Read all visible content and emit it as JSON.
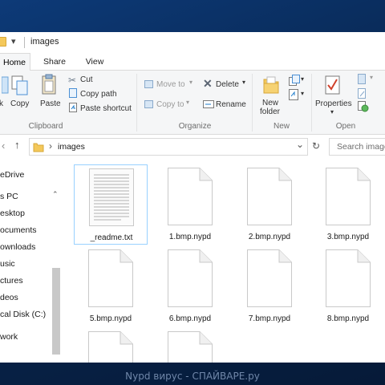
{
  "window": {
    "title": "images",
    "quick_access_glyph": "▾"
  },
  "tabs": [
    {
      "label": "Home",
      "active": true
    },
    {
      "label": "Share",
      "active": false
    },
    {
      "label": "View",
      "active": false
    }
  ],
  "ribbon": {
    "clipboard": {
      "pin_label_fragment": "k",
      "copy": "Copy",
      "paste": "Paste",
      "cut": "Cut",
      "copy_path": "Copy path",
      "paste_shortcut": "Paste shortcut",
      "group": "Clipboard"
    },
    "organize": {
      "move_to": "Move to",
      "copy_to": "Copy to",
      "delete": "Delete",
      "rename": "Rename",
      "group": "Organize"
    },
    "new": {
      "new_folder_line1": "New",
      "new_folder_line2": "folder",
      "group": "New"
    },
    "open": {
      "properties": "Properties",
      "group": "Open"
    }
  },
  "address": {
    "back_glyph": "‹",
    "up_glyph": "↑",
    "separator": "›",
    "path": "images",
    "dropdown_glyph": "⌄",
    "refresh_glyph": "↻",
    "search_placeholder": "Search images"
  },
  "nav_pane": {
    "items": [
      {
        "label": "eDrive"
      },
      {
        "label": "s PC"
      },
      {
        "label": "esktop"
      },
      {
        "label": "ocuments"
      },
      {
        "label": "ownloads"
      },
      {
        "label": "usic"
      },
      {
        "label": "ctures"
      },
      {
        "label": "deos"
      },
      {
        "label": "cal Disk (C:)"
      },
      {
        "label": "work"
      }
    ]
  },
  "files": [
    {
      "name": "_readme.txt",
      "type": "txt",
      "selected": true
    },
    {
      "name": "1.bmp.nypd",
      "type": "blank",
      "selected": false
    },
    {
      "name": "2.bmp.nypd",
      "type": "blank",
      "selected": false
    },
    {
      "name": "3.bmp.nypd",
      "type": "blank",
      "selected": false
    },
    {
      "name": "5.bmp.nypd",
      "type": "blank",
      "selected": false
    },
    {
      "name": "6.bmp.nypd",
      "type": "blank",
      "selected": false
    },
    {
      "name": "7.bmp.nypd",
      "type": "blank",
      "selected": false
    },
    {
      "name": "8.bmp.nypd",
      "type": "blank",
      "selected": false
    }
  ],
  "watermark": "Nypd вирус - СПАЙВАРЕ.ру",
  "colors": {
    "accent_blue": "#1979ca",
    "folder_yellow": "#f4c85a",
    "selection_border": "#99d1ff",
    "desktop": "#0b2a55"
  }
}
